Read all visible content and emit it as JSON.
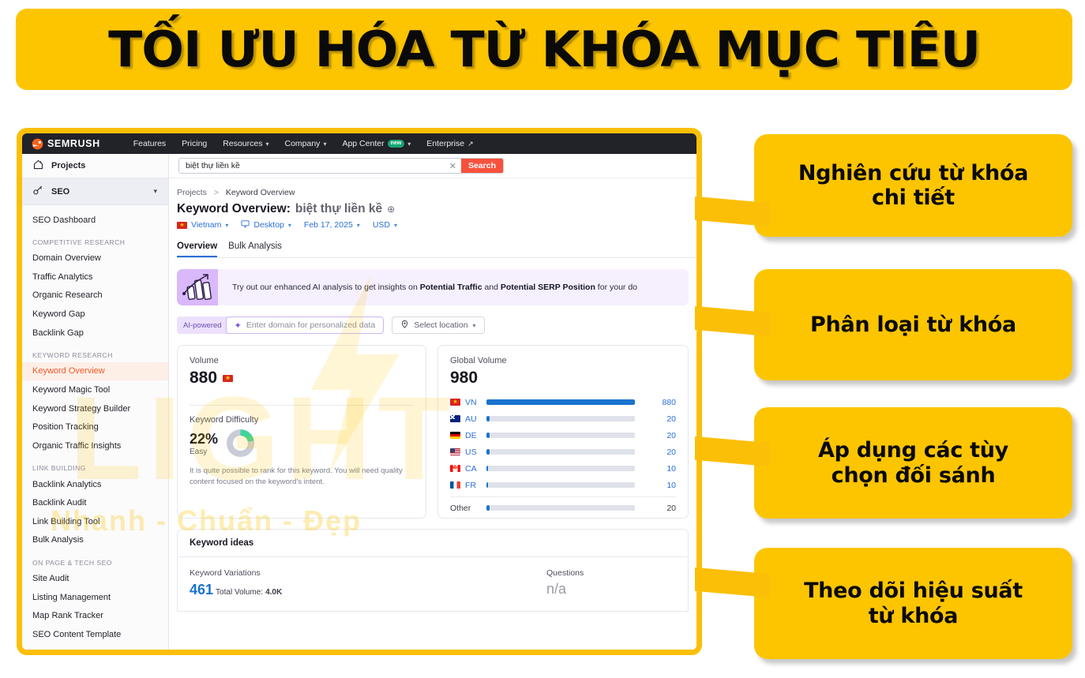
{
  "banner": {
    "title": "TỐI ƯU HÓA TỪ KHÓA MỤC TIÊU"
  },
  "colors": {
    "brand_yellow": "#FDC500",
    "frame_yellow": "#FBBF08",
    "semrush_orange": "#F7513D",
    "link_blue": "#2B6FD6",
    "bar_blue": "#1A73CF",
    "active_item": "#EF5B2B",
    "kd_green": "#3ED49A"
  },
  "callouts": [
    {
      "line1": "Nghiên cứu từ khóa",
      "line2": "chi tiết"
    },
    {
      "line1": "Phân loại từ khóa",
      "line2": ""
    },
    {
      "line1": "Áp dụng các tùy",
      "line2": "chọn đối sánh"
    },
    {
      "line1": "Theo dõi hiệu suất",
      "line2": "từ khóa"
    }
  ],
  "watermark": {
    "word": "LIGHT",
    "sub": "Nhanh - Chuẩn - Đẹp"
  },
  "topnav": {
    "logo": "SEMRUSH",
    "logo_icon": "semrush-logo-icon",
    "items": [
      {
        "label": "Features",
        "caret": false,
        "badge": "",
        "external": false
      },
      {
        "label": "Pricing",
        "caret": false,
        "badge": "",
        "external": false
      },
      {
        "label": "Resources",
        "caret": true,
        "badge": "",
        "external": false
      },
      {
        "label": "Company",
        "caret": true,
        "badge": "",
        "external": false
      },
      {
        "label": "App Center",
        "caret": true,
        "badge": "new",
        "external": false
      },
      {
        "label": "Enterprise",
        "caret": false,
        "badge": "",
        "external": true
      }
    ]
  },
  "sidebar": {
    "projects": {
      "label": "Projects",
      "icon": "home-icon"
    },
    "seo": {
      "label": "SEO",
      "icon": "key-icon",
      "caret": "chevron-down-icon"
    },
    "dashboard": "SEO Dashboard",
    "groups": [
      {
        "heading": "COMPETITIVE RESEARCH",
        "items": [
          "Domain Overview",
          "Traffic Analytics",
          "Organic Research",
          "Keyword Gap",
          "Backlink Gap"
        ]
      },
      {
        "heading": "KEYWORD RESEARCH",
        "items": [
          "Keyword Overview",
          "Keyword Magic Tool",
          "Keyword Strategy Builder",
          "Position Tracking",
          "Organic Traffic Insights"
        ]
      },
      {
        "heading": "LINK BUILDING",
        "items": [
          "Backlink Analytics",
          "Backlink Audit",
          "Link Building Tool",
          "Bulk Analysis"
        ]
      },
      {
        "heading": "ON PAGE & TECH SEO",
        "items": [
          "Site Audit",
          "Listing Management",
          "Map Rank Tracker",
          "SEO Content Template"
        ]
      }
    ],
    "active_item": "Keyword Overview"
  },
  "search": {
    "value": "biệt thự liền kề",
    "clear_icon": "close-icon",
    "button_label": "Search"
  },
  "breadcrumb": {
    "root": "Projects",
    "sep": ">",
    "current": "Keyword Overview"
  },
  "page": {
    "title_prefix": "Keyword Overview:",
    "keyword": "biệt thự liền kề",
    "add_icon": "plus-circle-icon"
  },
  "filters": [
    {
      "label": "Vietnam",
      "icon": "flag-vn-icon",
      "caret": true
    },
    {
      "label": "Desktop",
      "icon": "monitor-icon",
      "caret": true
    },
    {
      "label": "Feb 17, 2025",
      "icon": "",
      "caret": true
    },
    {
      "label": "USD",
      "icon": "",
      "caret": true
    }
  ],
  "tabs": [
    {
      "label": "Overview",
      "active": true
    },
    {
      "label": "Bulk Analysis",
      "active": false
    }
  ],
  "ai_banner": {
    "icon": "ai-chart-icon",
    "text_1": "Try out our enhanced AI analysis to get insights on ",
    "bold_1": "Potential Traffic",
    "text_2": " and ",
    "bold_2": "Potential SERP Position",
    "text_3": " for your do"
  },
  "ai_row": {
    "chip": "AI-powered",
    "spark_icon": "sparkle-icon",
    "domain_placeholder": "Enter domain for personalized data",
    "location_label": "Select location",
    "location_icon": "map-pin-icon",
    "caret_icon": "chevron-down-icon"
  },
  "volume_card": {
    "label": "Volume",
    "value": "880",
    "flag": "flag-vn-icon",
    "kd_label": "Keyword Difficulty",
    "kd_value": "22%",
    "kd_level": "Easy",
    "kd_percent": 22,
    "kd_note": "It is quite possible to rank for this keyword. You will need quality content focused on the keyword's intent."
  },
  "chart_data": {
    "type": "bar",
    "title": "Global Volume",
    "total": "980",
    "orientation": "horizontal",
    "categories": [
      "VN",
      "AU",
      "DE",
      "US",
      "CA",
      "FR",
      "Other"
    ],
    "values": [
      880,
      20,
      20,
      20,
      10,
      10,
      20
    ],
    "value_labels": [
      "880",
      "20",
      "20",
      "20",
      "10",
      "10",
      "20"
    ],
    "flags": [
      "flag-vn-icon",
      "flag-au-icon",
      "flag-de-icon",
      "flag-us-icon",
      "flag-ca-icon",
      "flag-fr-icon",
      ""
    ],
    "xlabel": "",
    "ylabel": "",
    "xlim": [
      0,
      880
    ],
    "grid": false,
    "legend": false
  },
  "ideas": {
    "heading": "Keyword ideas",
    "variations_label": "Keyword Variations",
    "variations_count": "461",
    "total_volume_prefix": "Total Volume:",
    "total_volume": "4.0K",
    "questions_label": "Questions",
    "questions_value": "n/a"
  }
}
